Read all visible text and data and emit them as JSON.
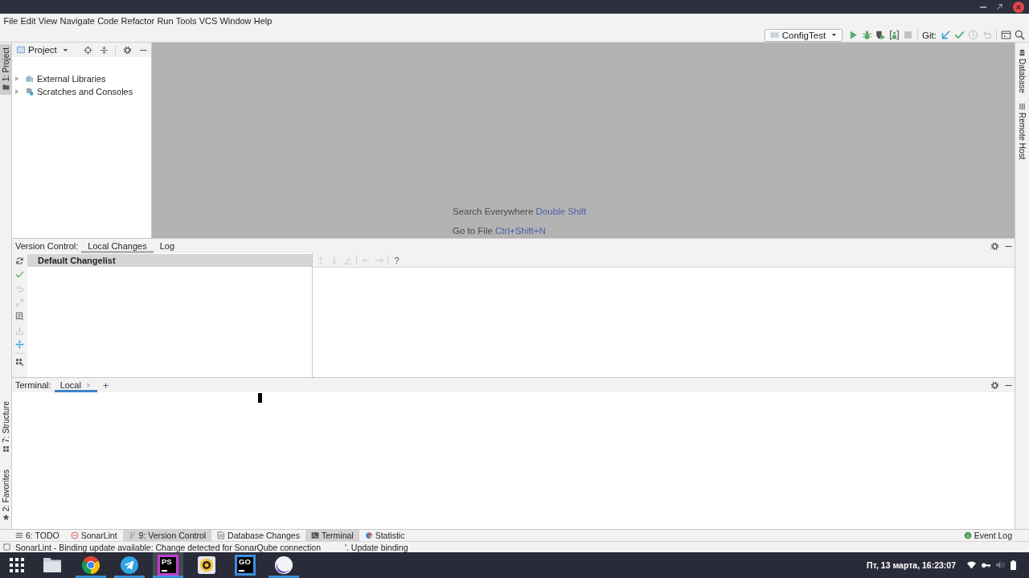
{
  "menu": [
    "File",
    "Edit",
    "View",
    "Navigate",
    "Code",
    "Refactor",
    "Run",
    "Tools",
    "VCS",
    "Window",
    "Help"
  ],
  "toolbar": {
    "run_config": "ConfigTest",
    "run_actions": [
      {
        "kind": "run",
        "disabled": false
      },
      {
        "kind": "debug",
        "disabled": false
      },
      {
        "kind": "coverage",
        "disabled": false
      },
      {
        "kind": "profile",
        "disabled": false
      },
      {
        "kind": "stop",
        "disabled": true
      }
    ],
    "vcs_label": "Git:",
    "vcs_actions": [
      {
        "kind": "update",
        "disabled": false
      },
      {
        "kind": "commit",
        "disabled": false
      },
      {
        "kind": "history",
        "disabled": true
      },
      {
        "kind": "revert",
        "disabled": true
      }
    ],
    "view_actions": [
      {
        "kind": "layout",
        "disabled": false
      },
      {
        "kind": "search",
        "disabled": false
      }
    ]
  },
  "left_stripe": {
    "top": [
      {
        "kind": "project",
        "label": "1: Project",
        "selected": true
      }
    ],
    "bottom": [
      {
        "kind": "structure",
        "label": "7: Structure",
        "selected": false
      },
      {
        "kind": "favorites",
        "label": "2: Favorites",
        "selected": false
      }
    ]
  },
  "project_panel": {
    "title": "Project",
    "tree": [
      {
        "kind": "libraries",
        "label": "External Libraries",
        "expanded": false
      },
      {
        "kind": "scratches",
        "label": "Scratches and Consoles",
        "expanded": false
      }
    ]
  },
  "editor": {
    "hints": [
      {
        "action": "Search Everywhere",
        "shortcut": "Double Shift"
      },
      {
        "action": "Go to File",
        "shortcut": "Ctrl+Shift+N"
      }
    ]
  },
  "right_stripe": [
    {
      "kind": "database",
      "label": "Database",
      "selected": false
    },
    {
      "kind": "remote",
      "label": "Remote Host",
      "selected": false
    }
  ],
  "version_control": {
    "title": "Version Control:",
    "focused": false,
    "tabs": [
      {
        "label": "Local Changes",
        "selected": true
      },
      {
        "label": "Log",
        "selected": false
      }
    ],
    "toolbar": [
      [
        {
          "kind": "refresh",
          "disabled": false
        },
        {
          "kind": "commit",
          "disabled": false
        },
        {
          "kind": "rollback",
          "disabled": true
        },
        {
          "kind": "diff",
          "disabled": true
        },
        {
          "kind": "shelf",
          "disabled": false
        },
        {
          "kind": "unshelve",
          "disabled": true
        },
        {
          "kind": "move",
          "disabled": false
        }
      ],
      [
        {
          "kind": "group",
          "disabled": false
        }
      ]
    ],
    "changelists": [
      {
        "label": "Default Changelist",
        "selected": true
      }
    ],
    "preview_toolbar": [
      [
        {
          "kind": "up",
          "disabled": true
        },
        {
          "kind": "down",
          "disabled": true
        },
        {
          "kind": "edit",
          "disabled": true
        }
      ],
      [
        {
          "kind": "back",
          "disabled": true
        },
        {
          "kind": "forward",
          "disabled": true
        }
      ]
    ],
    "preview_help": "?"
  },
  "terminal": {
    "title": "Terminal:",
    "focused": true,
    "tabs": [
      {
        "label": "Local",
        "close": "×",
        "selected": true
      }
    ],
    "new_tab": "+"
  },
  "tool_window_bar": {
    "left": [
      {
        "kind": "todo",
        "label": "6: TODO",
        "selected": false
      },
      {
        "kind": "sonarlint",
        "label": "SonarLint",
        "selected": false
      },
      {
        "kind": "vcs",
        "label": "9: Version Control",
        "selected": true
      },
      {
        "kind": "db_changes",
        "label": "Database Changes",
        "selected": false
      },
      {
        "kind": "terminal",
        "label": "Terminal",
        "selected": true
      },
      {
        "kind": "statistic",
        "label": "Statistic",
        "selected": false
      }
    ],
    "right": [
      {
        "kind": "event_log",
        "label": "Event Log",
        "selected": false
      }
    ]
  },
  "status_bar": {
    "message": [
      "SonarLint - Binding update available: Change detected for SonarQube connection",
      "'. Update binding"
    ]
  },
  "taskbar": {
    "apps": [
      {
        "kind": "files",
        "running": false,
        "selected": false
      },
      {
        "kind": "browser",
        "running": true,
        "selected": false
      },
      {
        "kind": "messenger",
        "running": true,
        "selected": false
      },
      {
        "kind": "ide",
        "badge": "PS",
        "color": "#c23fd1",
        "running": true,
        "selected": true
      },
      {
        "kind": "player",
        "running": false,
        "selected": false
      },
      {
        "kind": "ide",
        "badge": "GO",
        "color": "#3a8ee0",
        "running": false,
        "selected": false
      },
      {
        "kind": "orb",
        "running": true,
        "selected": false
      }
    ],
    "clock": "Пт, 13 марта, 16:23:07"
  }
}
